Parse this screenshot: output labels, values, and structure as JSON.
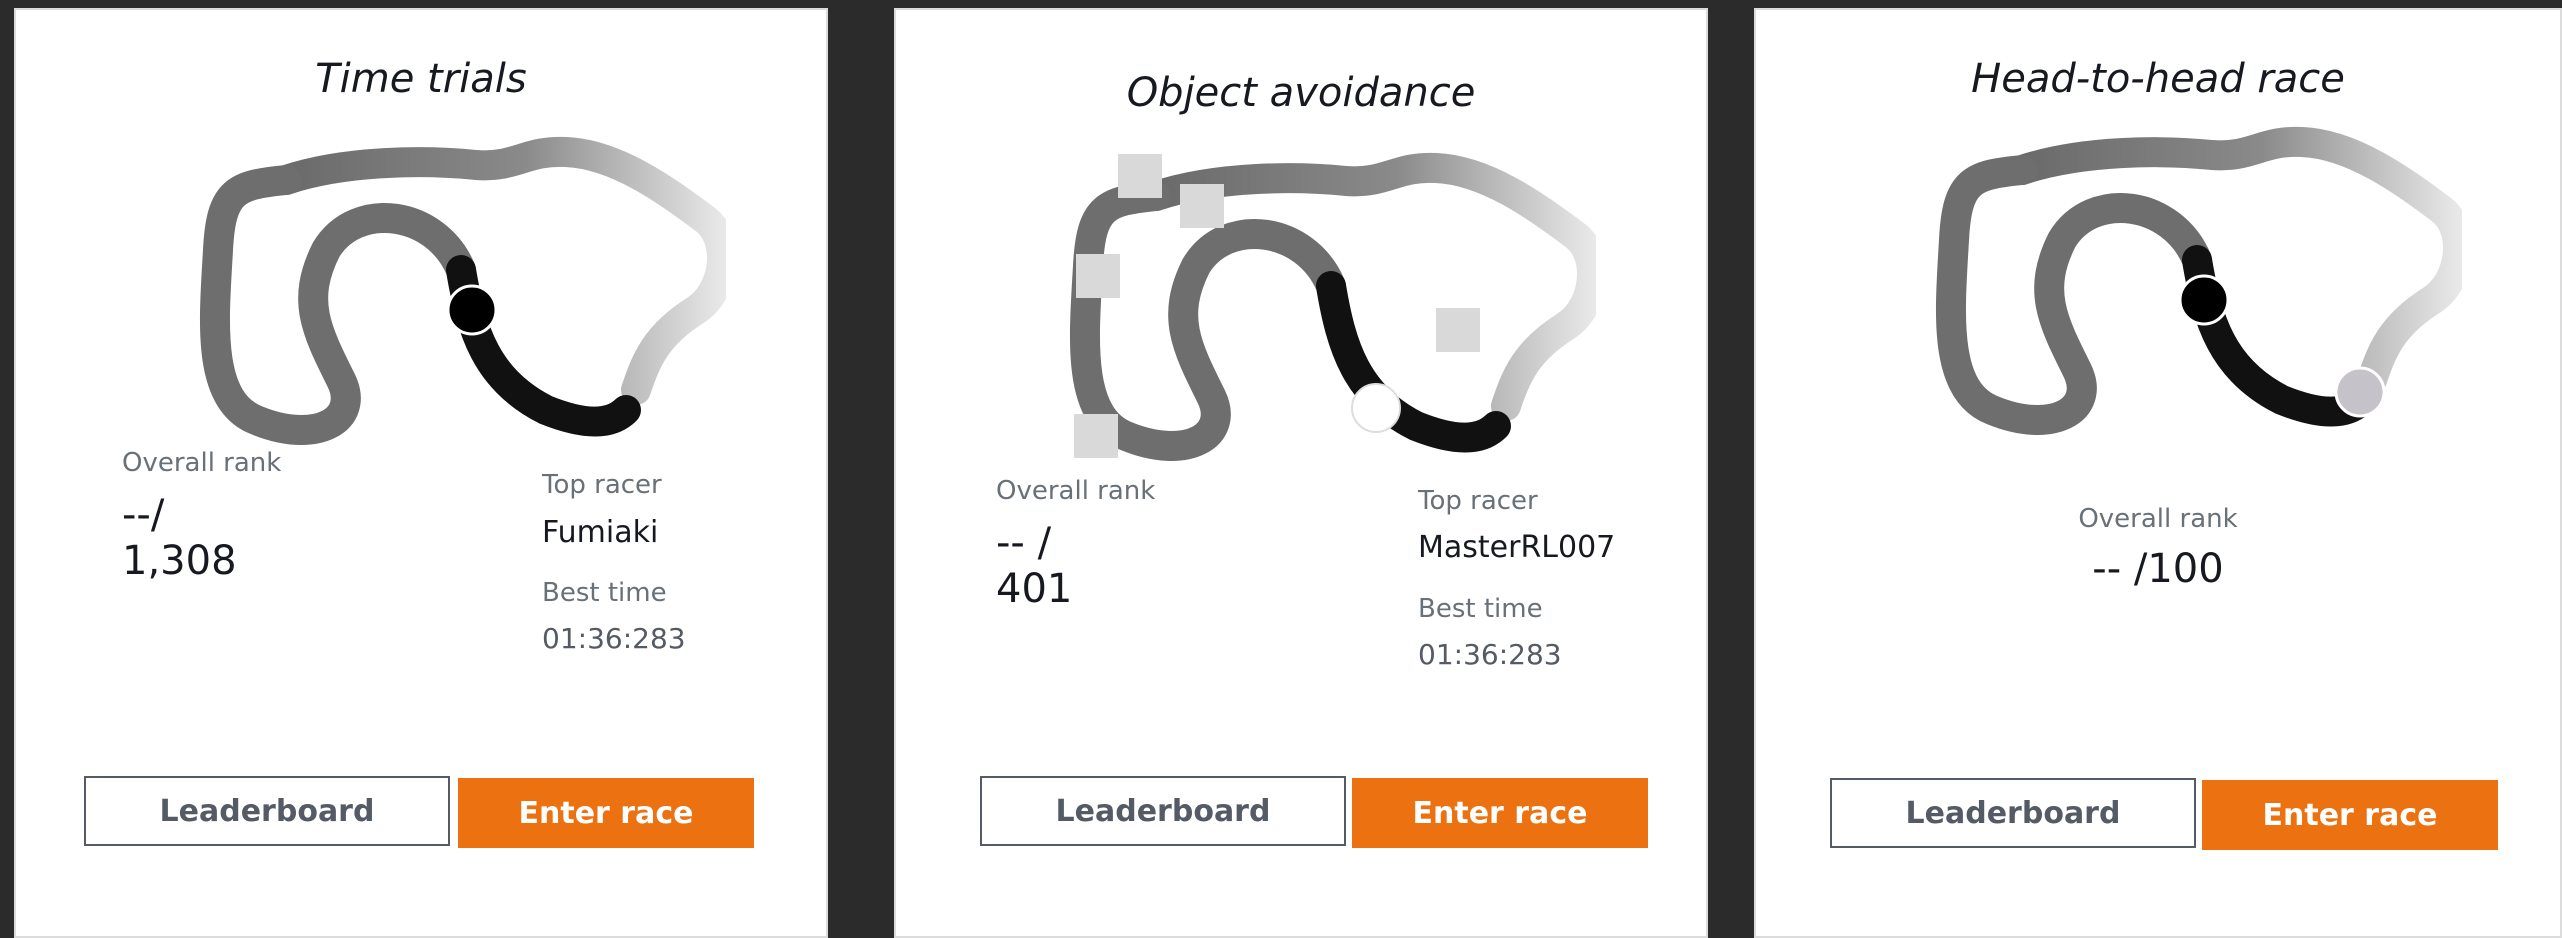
{
  "cards": [
    {
      "title": "Time trials",
      "overall_rank_label": "Overall rank",
      "rank_current": "--/",
      "rank_total": "1,308",
      "top_racer_label": "Top racer",
      "top_racer": "Fumiaki",
      "best_time_label": "Best time",
      "best_time": "01:36:283",
      "leaderboard_label": "Leaderboard",
      "enter_label": "Enter race"
    },
    {
      "title": "Object avoidance",
      "overall_rank_label": "Overall rank",
      "rank_current": "-- /",
      "rank_total": "401",
      "top_racer_label": "Top racer",
      "top_racer": "MasterRL007",
      "best_time_label": "Best time",
      "best_time": "01:36:283",
      "leaderboard_label": "Leaderboard",
      "enter_label": "Enter race"
    },
    {
      "title": "Head-to-head race",
      "overall_rank_label": "Overall rank",
      "rank": "-- /100",
      "leaderboard_label": "Leaderboard",
      "enter_label": "Enter race"
    }
  ],
  "colors": {
    "primary": "#ec7211",
    "background": "#2b2b2b",
    "card": "#ffffff",
    "text": "#16191f",
    "muted": "#687078"
  },
  "icons": [
    "race-track-icon",
    "car-marker-icon",
    "obstacle-icon"
  ]
}
